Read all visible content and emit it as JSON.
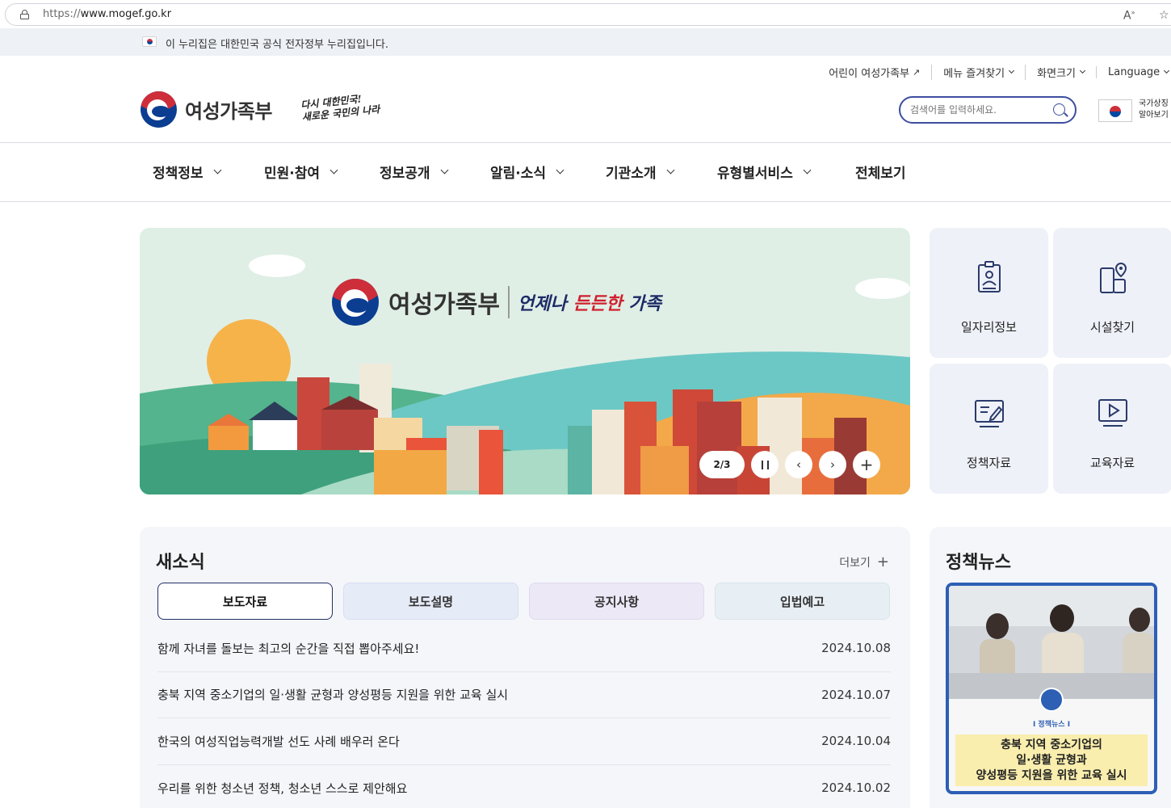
{
  "browser": {
    "url_proto": "https://",
    "url_host": "www.mogef.go.kr",
    "read_aloud_icon": "read-aloud-icon",
    "favorite_icon": "star-icon"
  },
  "gov_banner": {
    "text": "이 누리집은 대한민국 공식 전자정부 누리집입니다."
  },
  "util_nav": {
    "kids": "어린이 여성가족부",
    "favorites": "메뉴 즐겨찾기",
    "zoom": "화면크기",
    "language": "Language"
  },
  "header": {
    "logo_name": "여성가족부",
    "slogan_line1": "다시 대한민국!",
    "slogan_line2": "새로운 국민의 나라",
    "search_placeholder": "검색어를 입력하세요.",
    "national_symbol_line1": "국가상징",
    "national_symbol_line2": "알아보기"
  },
  "gnb": [
    {
      "label": "정책정보"
    },
    {
      "label": "민원·참여"
    },
    {
      "label": "정보공개"
    },
    {
      "label": "알림·소식"
    },
    {
      "label": "기관소개"
    },
    {
      "label": "유형별서비스"
    },
    {
      "label": "전체보기"
    }
  ],
  "hero": {
    "name": "여성가족부",
    "slogan_a": "언제나",
    "slogan_b": "든든한",
    "slogan_c": "가족",
    "pager": "2/3"
  },
  "quick_links": [
    {
      "label": "일자리정보",
      "icon": "id-card-icon"
    },
    {
      "label": "시설찾기",
      "icon": "building-pin-icon"
    },
    {
      "label": "정책자료",
      "icon": "document-edit-icon"
    },
    {
      "label": "교육자료",
      "icon": "video-play-icon"
    }
  ],
  "news": {
    "title": "새소식",
    "more": "더보기",
    "tabs": [
      "보도자료",
      "보도설명",
      "공지사항",
      "입법예고"
    ],
    "active_tab": "보도자료",
    "items": [
      {
        "title": "함께 자녀를 돌보는 최고의 순간을 직접 뽑아주세요!",
        "date": "2024.10.08"
      },
      {
        "title": "충북 지역 중소기업의 일·생활 균형과 양성평등 지원을 위한 교육 실시",
        "date": "2024.10.07"
      },
      {
        "title": "한국의 여성직업능력개발 선도 사례 배우러 온다",
        "date": "2024.10.04"
      },
      {
        "title": "우리를 위한 청소년 정책, 청소년 스스로 제안해요",
        "date": "2024.10.02"
      }
    ]
  },
  "policy_news": {
    "title": "정책뉴스",
    "card_caption": "I 정책뉴스 I",
    "card_text": "충북 지역 중소기업의\n일·생활 균형과\n양성평등 지원을 위한 교육 실시"
  },
  "colors": {
    "brand_navy": "#223067",
    "search_border": "#3d4e9f",
    "card_border": "#2d5fb5"
  }
}
